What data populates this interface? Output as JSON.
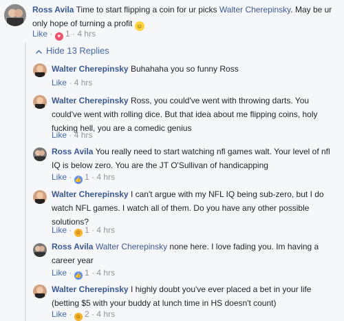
{
  "top_comment": {
    "author": "Ross Avila",
    "text": "Time to start flipping a coin for ur picks",
    "mention": "Walter Cherepinsky",
    "text2": ". May be ur only hope of turning a profit",
    "like_label": "Like",
    "reaction_count": "1",
    "time": "4 hrs"
  },
  "hide_replies_label": "Hide 13 Replies",
  "replies": [
    {
      "author": "Walter Cherepinsky",
      "text": "Buhahaha you so funny Ross",
      "like_label": "Like",
      "time": "4 hrs"
    },
    {
      "author": "Walter Cherepinsky",
      "text": "Ross, you could've went with throwing darts. You could've went with rolling dice. But that idea about me flipping coins, holy fucking hell, you are a comedic genius",
      "like_label": "Like",
      "time": "4 hrs"
    },
    {
      "author": "Ross Avila",
      "text": "You really need to start watching nfl games walt. Your level of nfl IQ is below zero. You are the JT O'Sullivan of handicapping",
      "like_label": "Like",
      "reaction_count": "1",
      "time": "4 hrs"
    },
    {
      "author": "Walter Cherepinsky",
      "text": "I can't argue with my NFL IQ being sub-zero, but I do watch NFL games. I watch all of them. Do you have any other possible solutions?",
      "like_label": "Like",
      "reaction_count": "1",
      "time": "4 hrs"
    },
    {
      "author": "Ross Avila",
      "mention": "Walter Cherepinsky",
      "text": "none here. I love fading you. Im having a career year",
      "like_label": "Like",
      "reaction_count": "1",
      "time": "4 hrs"
    },
    {
      "author": "Walter Cherepinsky",
      "text": "I highly doubt you've ever placed a bet in your life (betting $5 with your buddy at lunch time in HS doesn't count)",
      "like_label": "Like",
      "reaction_count": "2",
      "time": "4 hrs"
    }
  ],
  "separator": "·",
  "icons": {
    "heart": "heart-reaction-icon",
    "thumb": "like-reaction-icon",
    "haha": "haha-reaction-icon",
    "chevron": "chevron-up-icon"
  }
}
